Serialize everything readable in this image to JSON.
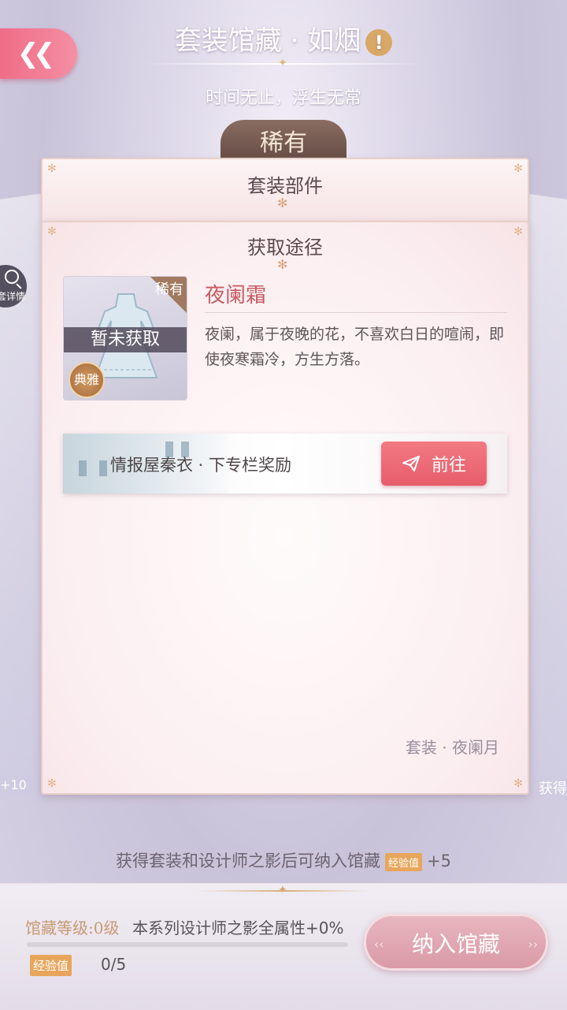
{
  "header": {
    "title": "套装馆藏 · 如烟",
    "info_icon": "!",
    "subtitle": "时间无止，浮生无常"
  },
  "back_button": {
    "icon": "double-chevron-left-icon",
    "glyph": "❮❮"
  },
  "rarity_plaque": "稀有",
  "side": {
    "detail_label": "套详情",
    "left_text": "+10",
    "right_text": "获得"
  },
  "panels": {
    "parts_title": "套装部件",
    "route_title": "获取途径"
  },
  "item": {
    "rarity": "稀有",
    "status": "暂未获取",
    "style": "典雅",
    "name": "夜阑霜",
    "description": "夜阑，属于夜晚的花，不喜欢白日的喧闹，即使夜寒霜冷，方生方落。"
  },
  "route": {
    "source": "情报屋秦衣 · 下专栏奖励",
    "go_button": "前往"
  },
  "suit_name": "套装 · 夜阑月",
  "bottom_hint": {
    "text": "获得套装和设计师之影后可纳入馆藏",
    "exp_badge": "经验值",
    "reward": "+5"
  },
  "footer": {
    "level": "馆藏等级:0级",
    "attribute": "本系列设计师之影全属性+0%",
    "exp_label": "经验值",
    "exp_count": "0/5",
    "progress_fraction": 0,
    "collect_button": "纳入馆藏"
  },
  "colors": {
    "accent_pink": "#f06c87",
    "gold": "#e8a65c",
    "item_name": "#c55b63"
  }
}
